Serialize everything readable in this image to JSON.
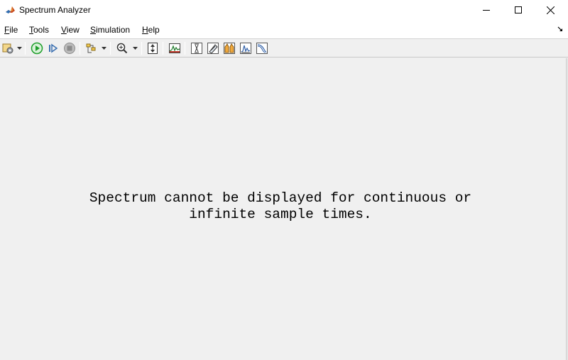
{
  "window": {
    "title": "Spectrum Analyzer",
    "icon": "matlab-membrane-icon",
    "controls": [
      "minimize-icon",
      "maximize-icon",
      "close-icon"
    ]
  },
  "menu": [
    {
      "label": "File",
      "mnemonic": "F",
      "rest": "ile"
    },
    {
      "label": "Tools",
      "mnemonic": "T",
      "rest": "ools"
    },
    {
      "label": "View",
      "mnemonic": "V",
      "rest": "iew"
    },
    {
      "label": "Simulation",
      "mnemonic": "S",
      "rest": "imulation"
    },
    {
      "label": "Help",
      "mnemonic": "H",
      "rest": "elp"
    }
  ],
  "toolbar": {
    "items": [
      "settings-icon",
      "run-icon",
      "step-forward-icon",
      "stop-icon",
      "highlight-signal-icon",
      "zoom-in-icon",
      "scale-axes-icon",
      "spectrum-settings-icon",
      "cursor-measurements-icon",
      "peak-finder-icon",
      "channel-measurements-icon",
      "distortion-measurements-icon",
      "ccdf-measurements-icon"
    ]
  },
  "content": {
    "message_line1": "Spectrum cannot be displayed for continuous or",
    "message_line2": "infinite sample times."
  },
  "colors": {
    "background": "#f0f0f0",
    "titlebar": "#ffffff",
    "run_green": "#1e9e2a",
    "stop_gray": "#8c8c8c"
  }
}
